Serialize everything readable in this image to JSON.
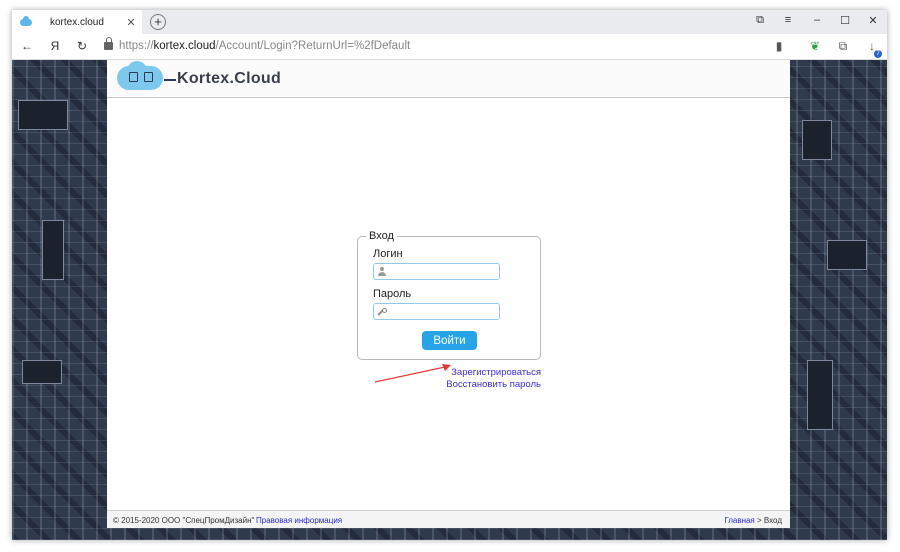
{
  "browser": {
    "tab_title": "kortex.cloud",
    "new_tab": "+",
    "url_prefix": "https://",
    "url_domain": "kortex.cloud",
    "url_path": "/Account/Login?ReturnUrl=%2fDefault",
    "yandex_button": "Я",
    "download_badge": "7"
  },
  "site": {
    "logo_text": "Kortex.Cloud"
  },
  "login": {
    "legend": "Вход",
    "login_label": "Логин",
    "password_label": "Пароль",
    "submit_label": "Войти",
    "register_link": "Зарегистрироваться",
    "restore_link": "Восстановить пароль"
  },
  "footer": {
    "copyright": "© 2015-2020 ООО \"СпецПромДизайн\"",
    "legal_link": "Правовая информация",
    "breadcrumb_home": "Главная",
    "breadcrumb_sep": " > ",
    "breadcrumb_current": "Вход"
  },
  "colors": {
    "accent_button": "#27a3e8",
    "link": "#3e2fd0",
    "annotation_arrow": "#e03a3a"
  }
}
